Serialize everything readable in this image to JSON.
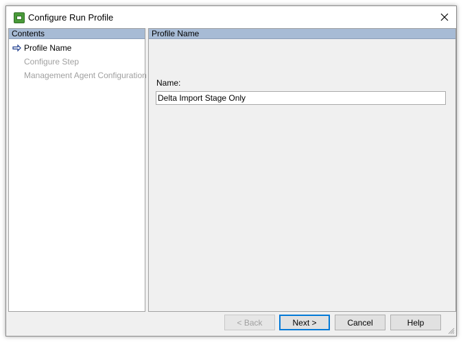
{
  "window": {
    "title": "Configure Run Profile"
  },
  "icons": {
    "app": "app-icon",
    "close": "close-icon",
    "arrow": "right-arrow-icon",
    "grip": "resize-grip-icon"
  },
  "left_panel": {
    "header": "Contents",
    "items": [
      {
        "label": "Profile Name",
        "active": true
      },
      {
        "label": "Configure Step",
        "active": false
      },
      {
        "label": "Management Agent Configuration",
        "active": false
      }
    ]
  },
  "right_panel": {
    "header": "Profile Name",
    "name_label": "Name:",
    "name_value": "Delta Import Stage Only"
  },
  "buttons": {
    "back": "< Back",
    "next": "Next >",
    "cancel": "Cancel",
    "help": "Help"
  },
  "colors": {
    "header_bg": "#a7bbd5",
    "default_button_border": "#0078d7",
    "disabled_text": "#a0a0a0"
  }
}
